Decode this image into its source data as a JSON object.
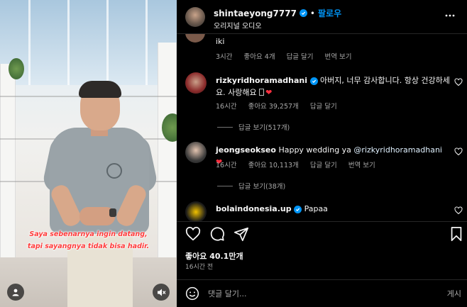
{
  "video": {
    "subtitle_line1": "Saya sebenarnya ingin datang,",
    "subtitle_line2": "tapi sayangnya tidak bisa hadir.",
    "profile_icon": "person-icon",
    "mute_icon": "speaker-muted-icon"
  },
  "header": {
    "username": "shintaeyong7777",
    "follow_label": "팔로우",
    "subtitle": "오리지널 오디오",
    "more_icon": "more-horizontal-icon"
  },
  "comments": [
    {
      "text": "iki",
      "time": "3시간",
      "likes": "좋아요 4개",
      "reply": "답글 달기",
      "translate": "번역 보기"
    },
    {
      "username": "rizkyridhoramadhani",
      "text_line1": "아버지, 너무 감사합니다. 항상 건강하세",
      "text_line2": "요. 사랑해요 ",
      "time": "16시간",
      "likes": "좋아요 39,257개",
      "reply": "답글 달기",
      "view_replies": "답글 보기(517개)"
    },
    {
      "username": "jeongseokseo",
      "text": "Happy wedding ya ",
      "mention": "@rizkyridhoramadhani",
      "time": "16시간",
      "likes": "좋아요 10,113개",
      "reply": "답글 달기",
      "translate": "번역 보기",
      "view_replies": "답글 보기(38개)"
    },
    {
      "username": "bolaindonesia.up",
      "text": "Papaa"
    }
  ],
  "actions": {
    "like_icon": "heart-icon",
    "comment_icon": "comment-icon",
    "share_icon": "send-icon",
    "save_icon": "bookmark-icon",
    "likes_count": "좋아요 40.1만개",
    "post_time": "16시간 전"
  },
  "composer": {
    "emoji_icon": "emoji-icon",
    "placeholder": "댓글 달기...",
    "post_label": "게시"
  },
  "colors": {
    "background": "#000000",
    "accent_blue": "#0095f6",
    "muted_text": "#a8a8a8",
    "heart_red": "#ff3040",
    "subtitle_red": "#ff3b3b"
  }
}
